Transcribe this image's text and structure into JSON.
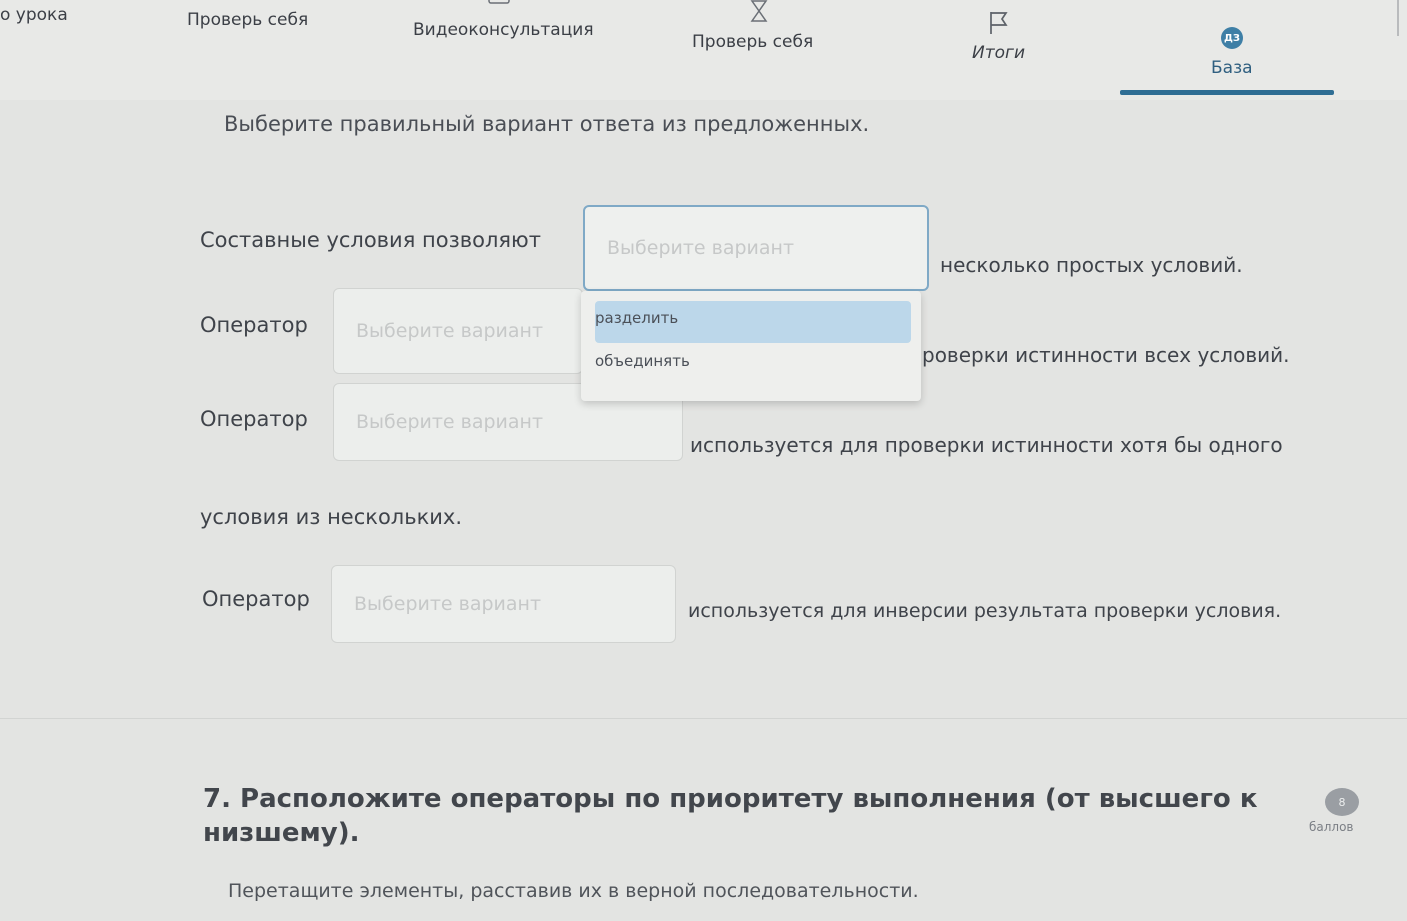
{
  "nav": {
    "tabs": [
      {
        "label": "о урока"
      },
      {
        "label": "Проверь себя"
      },
      {
        "label": "Видеоконсультация"
      },
      {
        "label": "Проверь себя"
      },
      {
        "label": "Итоги"
      },
      {
        "label": "База",
        "badge": "ДЗ",
        "active": true
      }
    ],
    "accent_color": "#2f6e94"
  },
  "question6": {
    "instruction": "Выберите правильный вариант ответа из предложенных.",
    "items": [
      {
        "prefix": "Составные условия позволяют",
        "placeholder": "Выберите вариант",
        "suffix": "несколько простых условий."
      },
      {
        "prefix": "Оператор",
        "placeholder": "Выберите вариант",
        "suffix": "роверки истинности всех условий."
      },
      {
        "prefix": "Оператор",
        "placeholder": "Выберите вариант",
        "suffix": "используется для проверки истинности хотя бы одного",
        "suffix_line2": "условия из нескольких."
      },
      {
        "prefix": "Оператор",
        "placeholder": "Выберите вариант",
        "suffix": "используется для инверсии результата проверки условия."
      }
    ],
    "dropdown": {
      "options": [
        "разделить",
        "объединять"
      ],
      "highlighted_index": 0
    }
  },
  "question7": {
    "title_line1": "7. Расположите операторы по приоритету выполнения (от высшего к",
    "title_line2": "низшему).",
    "score_value": "8",
    "score_label": "баллов",
    "instruction": "Перетащите элементы, расставив их в верной последовательности."
  }
}
